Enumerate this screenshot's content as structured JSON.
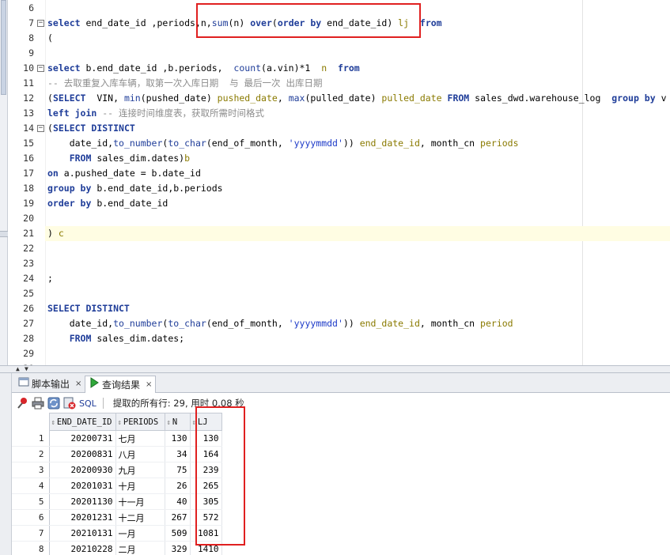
{
  "editor": {
    "lines": [
      {
        "n": "6",
        "fold": false,
        "html": ""
      },
      {
        "n": "7",
        "fold": true,
        "html": "<span class=\"kw\">select</span> end_date_id ,periods,n,<span class=\"fn\">sum</span>(n) <span class=\"kw\">over</span>(<span class=\"kw\">order by</span> end_date_id) <span class=\"al\">lj</span>  <span class=\"kw\">from</span>"
      },
      {
        "n": "8",
        "fold": false,
        "html": "("
      },
      {
        "n": "9",
        "fold": false,
        "html": ""
      },
      {
        "n": "10",
        "fold": true,
        "html": "<span class=\"kw\">select</span> b.end_date_id ,b.periods,  <span class=\"fn\">count</span>(a.vin)*1  <span class=\"al\">n</span>  <span class=\"kw\">from</span>"
      },
      {
        "n": "11",
        "fold": false,
        "html": "<span class=\"cm\">-- 去取重复入库车辆，取第一次入库日期  与 最后一次 出库日期</span>"
      },
      {
        "n": "12",
        "fold": false,
        "html": "(<span class=\"kw\">SELECT</span>  VIN, <span class=\"fn\">min</span>(pushed_date) <span class=\"al\">pushed_date</span>, <span class=\"fn\">max</span>(pulled_date) <span class=\"al\">pulled_date</span> <span class=\"kw\">FROM</span> sales_dwd.warehouse_log  <span class=\"kw\">group by</span> v"
      },
      {
        "n": "13",
        "fold": false,
        "html": "<span class=\"kw\">left join</span> <span class=\"cm\">-- 连接时间维度表，获取所需时间格式</span>"
      },
      {
        "n": "14",
        "fold": true,
        "html": "(<span class=\"kw\">SELECT DISTINCT</span>"
      },
      {
        "n": "15",
        "fold": false,
        "html": "    date_id,<span class=\"fn\">to_number</span>(<span class=\"fn\">to_char</span>(end_of_month, <span class=\"str\">'yyyymmdd'</span>)) <span class=\"al\">end_date_id</span>, month_cn <span class=\"al\">periods</span>"
      },
      {
        "n": "16",
        "fold": false,
        "html": "    <span class=\"kw\">FROM</span> sales_dim.dates)<span class=\"al\">b</span>"
      },
      {
        "n": "17",
        "fold": false,
        "html": "<span class=\"kw\">on</span> a.pushed_date = b.date_id"
      },
      {
        "n": "18",
        "fold": false,
        "html": "<span class=\"kw\">group by</span> b.end_date_id,b.periods"
      },
      {
        "n": "19",
        "fold": false,
        "html": "<span class=\"kw\">order by</span> b.end_date_id"
      },
      {
        "n": "20",
        "fold": false,
        "html": ""
      },
      {
        "n": "21",
        "fold": false,
        "html": ") <span class=\"al\">c</span>",
        "highlight": true
      },
      {
        "n": "22",
        "fold": false,
        "html": ""
      },
      {
        "n": "23",
        "fold": false,
        "html": ""
      },
      {
        "n": "24",
        "fold": false,
        "html": ";"
      },
      {
        "n": "25",
        "fold": false,
        "html": ""
      },
      {
        "n": "26",
        "fold": false,
        "html": "<span class=\"kw\">SELECT DISTINCT</span>"
      },
      {
        "n": "27",
        "fold": false,
        "html": "    date_id,<span class=\"fn\">to_number</span>(<span class=\"fn\">to_char</span>(end_of_month, <span class=\"str\">'yyyymmdd'</span>)) <span class=\"al\">end_date_id</span>, month_cn <span class=\"al\">period</span>"
      },
      {
        "n": "28",
        "fold": false,
        "html": "    <span class=\"kw\">FROM</span> sales_dim.dates;"
      },
      {
        "n": "29",
        "fold": false,
        "html": ""
      },
      {
        "n": "30",
        "fold": false,
        "html": ""
      }
    ]
  },
  "tabs": {
    "script_output": "脚本输出",
    "query_result": "查询结果",
    "close": "×"
  },
  "toolbar": {
    "sql_label": "SQL",
    "status": "提取的所有行: 29, 用时 0.08 秒"
  },
  "grid": {
    "columns": [
      "END_DATE_ID",
      "PERIODS",
      "N",
      "LJ"
    ],
    "rows": [
      {
        "rn": "1",
        "end_date_id": "20200731",
        "periods": "七月",
        "n": "130",
        "lj": "130"
      },
      {
        "rn": "2",
        "end_date_id": "20200831",
        "periods": "八月",
        "n": "34",
        "lj": "164"
      },
      {
        "rn": "3",
        "end_date_id": "20200930",
        "periods": "九月",
        "n": "75",
        "lj": "239"
      },
      {
        "rn": "4",
        "end_date_id": "20201031",
        "periods": "十月",
        "n": "26",
        "lj": "265"
      },
      {
        "rn": "5",
        "end_date_id": "20201130",
        "periods": "十一月",
        "n": "40",
        "lj": "305"
      },
      {
        "rn": "6",
        "end_date_id": "20201231",
        "periods": "十二月",
        "n": "267",
        "lj": "572"
      },
      {
        "rn": "7",
        "end_date_id": "20210131",
        "periods": "一月",
        "n": "509",
        "lj": "1081"
      },
      {
        "rn": "8",
        "end_date_id": "20210228",
        "periods": "二月",
        "n": "329",
        "lj": "1410"
      }
    ]
  },
  "colors": {
    "keyword": "#1f3d99",
    "alias": "#8a7a00",
    "comment": "#8c8c8c",
    "annotation_box": "#e02020"
  }
}
